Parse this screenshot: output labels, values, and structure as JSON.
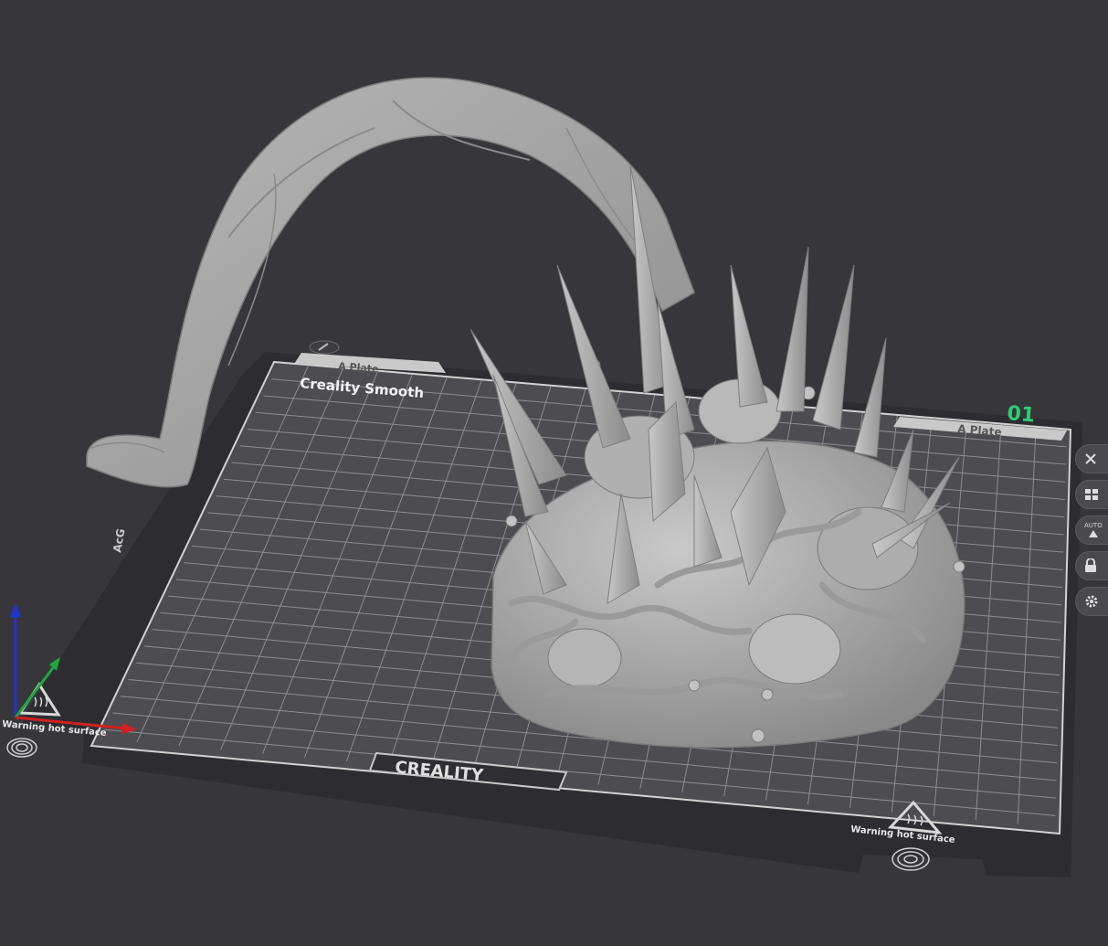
{
  "bed": {
    "title": "Creality Smooth",
    "plate_tab_left": "A Plate",
    "plate_tab_right": "A Plate",
    "plate_number": "01",
    "brand": "CREALITY",
    "warning_left": "Warning hot surface",
    "warning_right": "Warning hot surface"
  },
  "toolbar": {
    "buttons": [
      {
        "name": "close",
        "icon": "close-icon"
      },
      {
        "name": "arrange",
        "icon": "grid-icon"
      },
      {
        "name": "auto-orient",
        "icon": "auto-icon",
        "label": "AUTO"
      },
      {
        "name": "lock",
        "icon": "lock-icon"
      },
      {
        "name": "settings",
        "icon": "gear-icon"
      }
    ]
  },
  "colors": {
    "background": "#37373b",
    "bed": "#4d4d52",
    "bed_frame": "#2f2f33",
    "grid": "#8a8a8f",
    "model": "#a9a9a9",
    "plate_number": "#2ecc71",
    "axis_x": "#d21f1f",
    "axis_y": "#1fa83a",
    "axis_z": "#1f33d2"
  }
}
